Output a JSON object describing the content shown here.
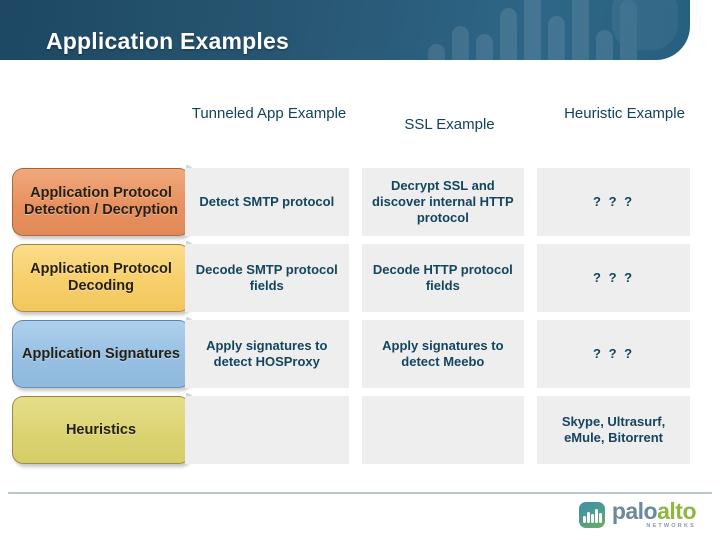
{
  "header": {
    "title": "Application Examples"
  },
  "columns": [
    {
      "label": "Tunneled App Example"
    },
    {
      "label": "SSL Example"
    },
    {
      "label": "Heuristic Example"
    }
  ],
  "stages": [
    {
      "label": "Application Protocol Detection / Decryption",
      "color": "#e8915f"
    },
    {
      "label": "Application Protocol Decoding",
      "color": "#f7cf6a"
    },
    {
      "label": "Application Signatures",
      "color": "#98c0e3"
    },
    {
      "label": "Heuristics",
      "color": "#dcd472"
    }
  ],
  "matrix": [
    {
      "cells": [
        "Detect SMTP protocol",
        "Decrypt SSL and discover internal HTTP protocol",
        "? ? ?"
      ]
    },
    {
      "cells": [
        "Decode SMTP protocol fields",
        "Decode HTTP protocol fields",
        "? ? ?"
      ]
    },
    {
      "cells": [
        "Apply signatures to detect HOSProxy",
        "Apply signatures to detect Meebo",
        "? ? ?"
      ]
    },
    {
      "cells": [
        "",
        "",
        "Skype, Ultrasurf, eMule, Bitorrent"
      ]
    }
  ],
  "brand": {
    "name_first": "palo",
    "name_second": "alto",
    "tagline": "NETWORKS"
  },
  "theme": {
    "header_blue": "#285773",
    "text_navy": "#14455f",
    "cell_gray": "#eeeeee",
    "rule_gray": "#b9c7d2"
  }
}
